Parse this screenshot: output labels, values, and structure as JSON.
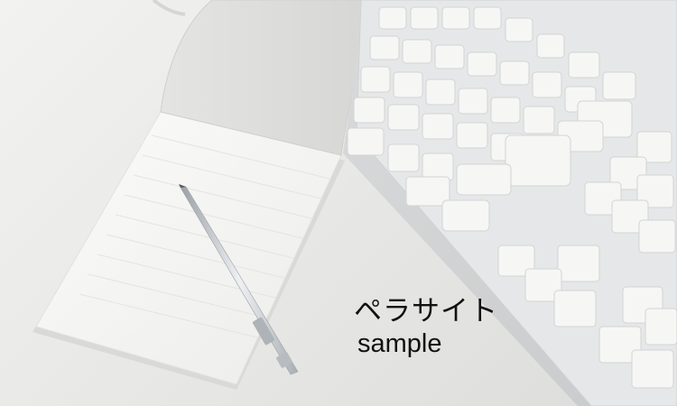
{
  "caption": {
    "line1": "ペラサイト",
    "line2": "sample"
  },
  "palette": {
    "background": "#e9e9e7",
    "paper": "#f7f7f5",
    "key": "#f4f4f2",
    "pencil": "#c9ccd0",
    "text": "#111111"
  },
  "objects": [
    "notepad",
    "mechanical-pencil",
    "keyboard"
  ]
}
